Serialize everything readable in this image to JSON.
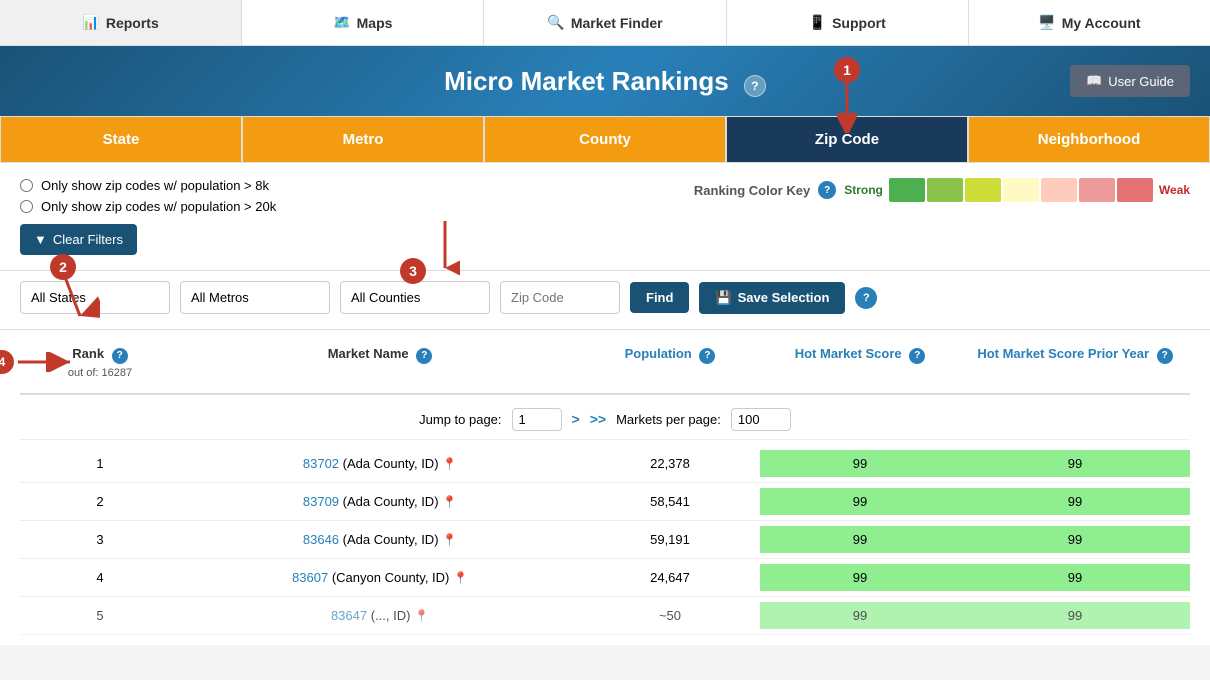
{
  "nav": {
    "items": [
      {
        "label": "Reports",
        "icon": "📊"
      },
      {
        "label": "Maps",
        "icon": "🗺️"
      },
      {
        "label": "Market Finder",
        "icon": "🔍"
      },
      {
        "label": "Support",
        "icon": "📱"
      },
      {
        "label": "My Account",
        "icon": "🖥️"
      }
    ]
  },
  "header": {
    "title": "Micro Market Rankings",
    "help_icon": "?",
    "user_guide_label": "User Guide"
  },
  "tabs": [
    {
      "label": "State",
      "key": "state"
    },
    {
      "label": "Metro",
      "key": "metro"
    },
    {
      "label": "County",
      "key": "county"
    },
    {
      "label": "Zip Code",
      "key": "zipcode",
      "active": true
    },
    {
      "label": "Neighborhood",
      "key": "neighborhood"
    }
  ],
  "filters": {
    "radio1": "Only show zip codes w/ population > 8k",
    "radio2": "Only show zip codes w/ population > 20k",
    "clear_filters_label": "Clear Filters",
    "ranking_color_key_label": "Ranking Color Key",
    "strong_label": "Strong",
    "weak_label": "Weak"
  },
  "dropdowns": {
    "states_default": "All States",
    "metros_default": "All Metros",
    "counties_default": "All Counties",
    "zip_placeholder": "Zip Code",
    "find_label": "Find",
    "save_selection_label": "Save Selection"
  },
  "table": {
    "col_rank": "Rank",
    "col_rank_sub": "out of: 16287",
    "col_market_name": "Market Name",
    "col_population": "Population",
    "col_hot_market_score": "Hot Market Score",
    "col_hot_market_score_prior": "Hot Market Score Prior Year",
    "jump_to_page_label": "Jump to page:",
    "page_value": "1",
    "markets_per_page_label": "Markets per page:",
    "per_page_value": "100",
    "rows": [
      {
        "rank": 1,
        "zip": "83702",
        "county": "Ada County, ID",
        "population": "22,378",
        "score": 99,
        "score_prior": 99
      },
      {
        "rank": 2,
        "zip": "83709",
        "county": "Ada County, ID",
        "population": "58,541",
        "score": 99,
        "score_prior": 99
      },
      {
        "rank": 3,
        "zip": "83646",
        "county": "Ada County, ID",
        "population": "59,191",
        "score": 99,
        "score_prior": 99
      },
      {
        "rank": 4,
        "zip": "83607",
        "county": "Canyon County, ID",
        "population": "24,647",
        "score": 99,
        "score_prior": 99
      },
      {
        "rank": 5,
        "zip": "83647",
        "county": "..., ID",
        "population": "~50",
        "score": 99,
        "score_prior": 99
      }
    ]
  },
  "annotations": {
    "badge1": "1",
    "badge2": "2",
    "badge3": "3",
    "badge4": "4"
  }
}
